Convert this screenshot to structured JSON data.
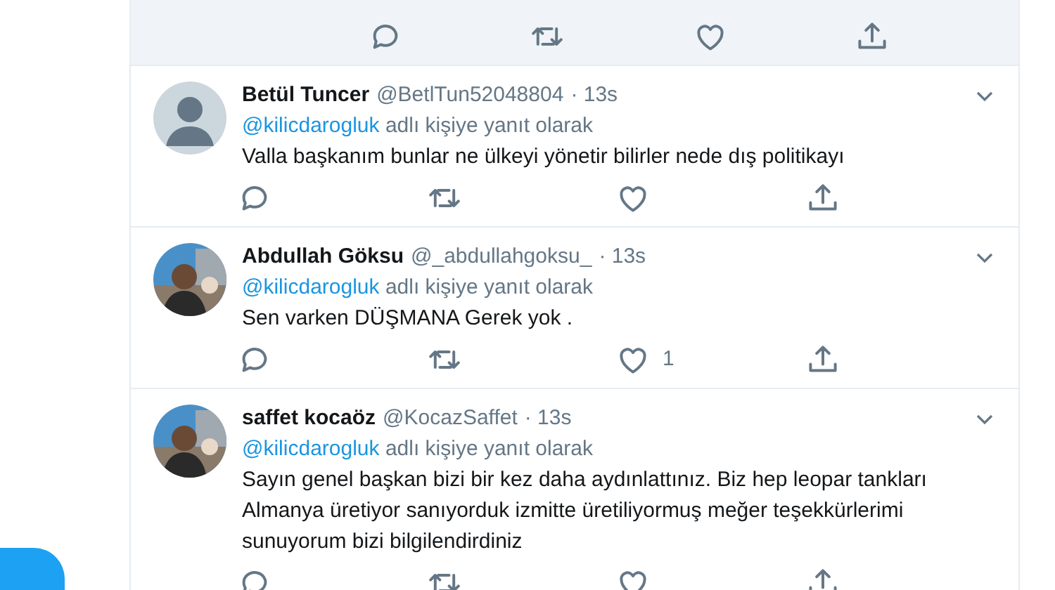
{
  "partial_tweet": {
    "highlighted": true
  },
  "tweets": [
    {
      "kind": "default",
      "name": "Betül Tuncer",
      "handle": "@BetlTun52048804",
      "time": "· 13s",
      "mention": "@kilicdarogluk",
      "reply_suffix": "adlı kişiye yanıt olarak",
      "text": "Valla başkanım bunlar ne ülkeyi yönetir bilirler nede dış politikayı"
    },
    {
      "kind": "picture",
      "name": "Abdullah Göksu",
      "handle": "@_abdullahgoksu_",
      "time": "· 13s",
      "mention": "@kilicdarogluk",
      "reply_suffix": "adlı kişiye yanıt olarak",
      "text": "Sen varken DÜŞMANA Gerek yok .",
      "like_count": "1"
    },
    {
      "kind": "picture",
      "name": "saffet kocaöz",
      "handle": "@KocazSaffet",
      "time": "· 13s",
      "mention": "@kilicdarogluk",
      "reply_suffix": "adlı kişiye yanıt olarak",
      "text": "Sayın genel başkan bizi bir kez daha aydınlattınız. Biz hep leopar tankları Almanya üretiyor sanıyorduk izmitte üretiliyormuş meğer teşekkürlerimi sunuyorum bizi bilgilendirdiniz"
    }
  ]
}
